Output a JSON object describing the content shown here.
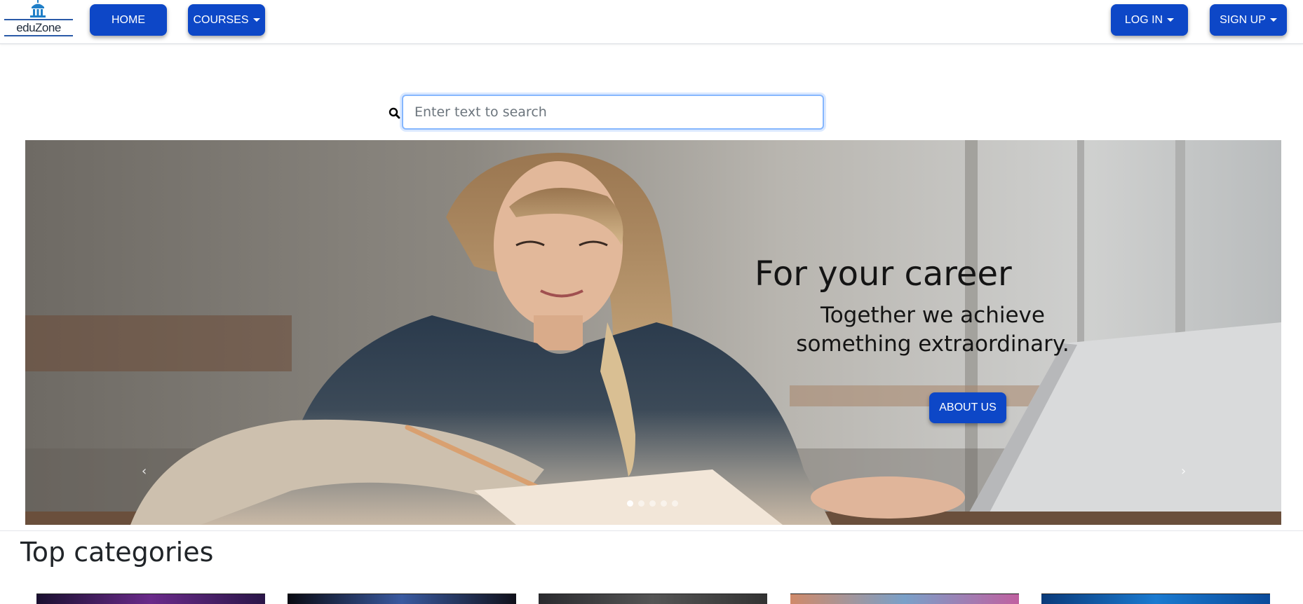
{
  "brand": {
    "name": "eduZone"
  },
  "nav": {
    "home_label": "HOME",
    "courses_label": "COURSES",
    "login_label": "LOG IN",
    "signup_label": "SIGN UP"
  },
  "search": {
    "placeholder": "Enter text to search",
    "value": ""
  },
  "hero": {
    "title": "For your career",
    "subtitle_line1": "Together we achieve",
    "subtitle_line2": "something extraordinary.",
    "cta_label": "ABOUT US",
    "prev_glyph": "‹",
    "next_glyph": "›",
    "slide_count": 5,
    "active_slide": 1
  },
  "categories": {
    "title": "Top categories"
  },
  "colors": {
    "accent": "#0d47c7",
    "text": "#141414"
  },
  "icons": {
    "search": "search-icon",
    "logo": "building-icon"
  }
}
